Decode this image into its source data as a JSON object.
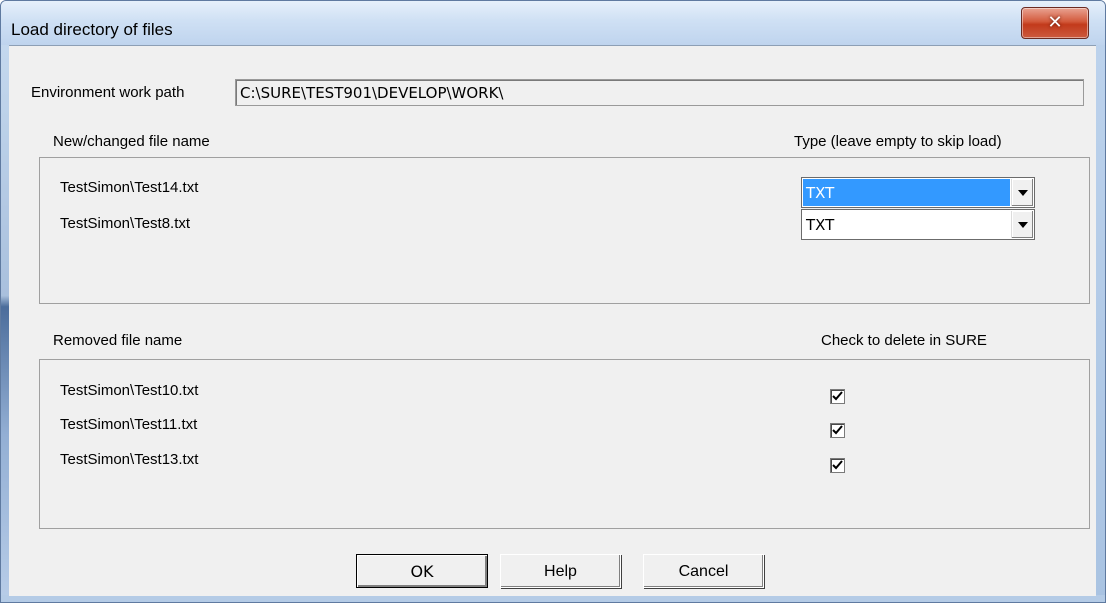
{
  "window": {
    "title": "Load directory of files",
    "close_glyph": "✕"
  },
  "env": {
    "label": "Environment work path",
    "value": "C:\\SURE\\TEST901\\DEVELOP\\WORK\\"
  },
  "changed": {
    "header_name": "New/changed file name",
    "header_type": "Type (leave empty to skip load)",
    "rows": [
      {
        "name": "TestSimon\\Test14.txt",
        "type": "TXT",
        "selected": true
      },
      {
        "name": "TestSimon\\Test8.txt",
        "type": "TXT",
        "selected": false
      }
    ]
  },
  "removed": {
    "header_name": "Removed file name",
    "header_check": "Check to delete in SURE",
    "rows": [
      {
        "name": "TestSimon\\Test10.txt",
        "checked": true
      },
      {
        "name": "TestSimon\\Test11.txt",
        "checked": true
      },
      {
        "name": "TestSimon\\Test13.txt",
        "checked": true
      }
    ]
  },
  "buttons": {
    "ok": "OK",
    "help": "Help",
    "cancel": "Cancel"
  },
  "colors": {
    "selection": "#3399ff",
    "close": "#c7462a",
    "dialog_bg": "#f0f0f0"
  }
}
